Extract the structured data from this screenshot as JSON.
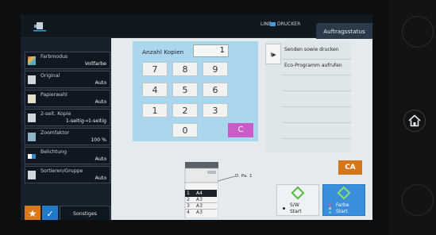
{
  "topbar": {
    "line_label": "LINE",
    "printer_label": "DRUCKER",
    "job_status": "Auftragsstatus",
    "printer_indicator_color": "#3d9ee0"
  },
  "functions": [
    {
      "label": "Farbmodus",
      "value": "Vollfarbe",
      "icon": "color-mode-icon"
    },
    {
      "label": "Original",
      "value": "Auto",
      "icon": "original-icon"
    },
    {
      "label": "Papierwahl",
      "value": "Auto",
      "icon": "paper-select-icon"
    },
    {
      "label": "2-seit. Kopie",
      "value": "1-seitig→1-seitig",
      "icon": "duplex-icon"
    },
    {
      "label": "Zoomfaktor",
      "value": "100 %",
      "icon": "zoom-icon"
    },
    {
      "label": "Belichtung",
      "value": "Auto",
      "icon": "exposure-icon"
    },
    {
      "label": "Sortieren/Gruppe",
      "value": "Auto",
      "icon": "sort-icon"
    }
  ],
  "bottom": {
    "star": "★",
    "check": "✓",
    "sonstiges": "Sonstiges"
  },
  "keypad": {
    "copies_label": "Anzahl Kopien",
    "copies_value": "1",
    "keys": [
      "7",
      "8",
      "9",
      "4",
      "5",
      "6",
      "1",
      "2",
      "3",
      "0"
    ],
    "clear": "C",
    "clear_color": "#c95cc6"
  },
  "right_panel": {
    "tab_glyph": "I▶",
    "items": [
      "Senden sowie drucken",
      "Eco-Programm aufrufen"
    ]
  },
  "trays": [
    {
      "n": "1",
      "size": "A4"
    },
    {
      "n": "2",
      "size": "A3"
    },
    {
      "n": "3",
      "size": "A3"
    },
    {
      "n": "4",
      "size": "A3"
    }
  ],
  "output": {
    "label": "D. Pa. 1"
  },
  "actions": {
    "ca": "CA",
    "bw_label": "S/W",
    "bw_start": "Start",
    "color_label": "Farbe",
    "color_start": "Start",
    "accent_orange": "#d47519",
    "accent_blue": "#3a8edc",
    "start_green": "#55b840"
  }
}
